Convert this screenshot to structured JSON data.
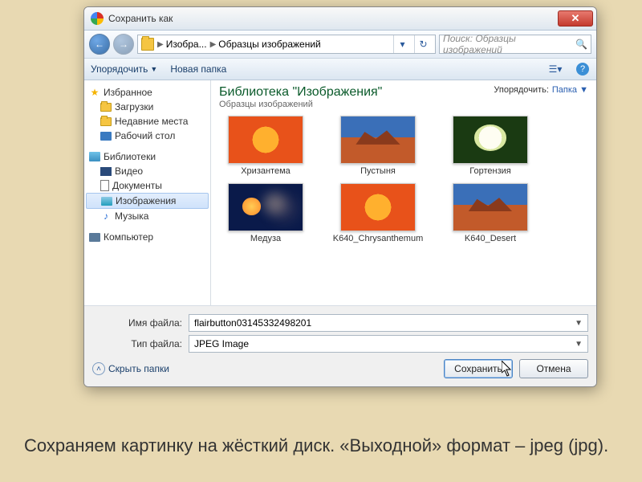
{
  "titlebar": {
    "title": "Сохранить как",
    "close": "✕"
  },
  "nav": {
    "path_a": "Изобра...",
    "path_b": "Образцы изображений",
    "search_placeholder": "Поиск: Образцы изображений"
  },
  "toolbar": {
    "organize": "Упорядочить",
    "newfolder": "Новая папка"
  },
  "sidebar": {
    "fav_hdr": "Избранное",
    "fav": [
      "Загрузки",
      "Недавние места",
      "Рабочий стол"
    ],
    "lib_hdr": "Библиотеки",
    "lib": [
      "Видео",
      "Документы",
      "Изображения",
      "Музыка"
    ],
    "pc_hdr": "Компьютер"
  },
  "content": {
    "title": "Библиотека \"Изображения\"",
    "subtitle": "Образцы изображений",
    "sort_label": "Упорядочить:",
    "sort_value": "Папка",
    "thumbs": [
      "Хризантема",
      "Пустыня",
      "Гортензия",
      "Медуза",
      "K640_Chrysanthemum",
      "K640_Desert"
    ]
  },
  "bottom": {
    "filename_label": "Имя файла:",
    "filename_value": "flairbutton03145332498201",
    "filetype_label": "Тип файла:",
    "filetype_value": "JPEG Image",
    "hide": "Скрыть папки",
    "save": "Сохранить",
    "cancel": "Отмена"
  },
  "caption": "Сохраняем картинку на жёсткий диск. «Выходной» формат – jpeg (jpg)."
}
